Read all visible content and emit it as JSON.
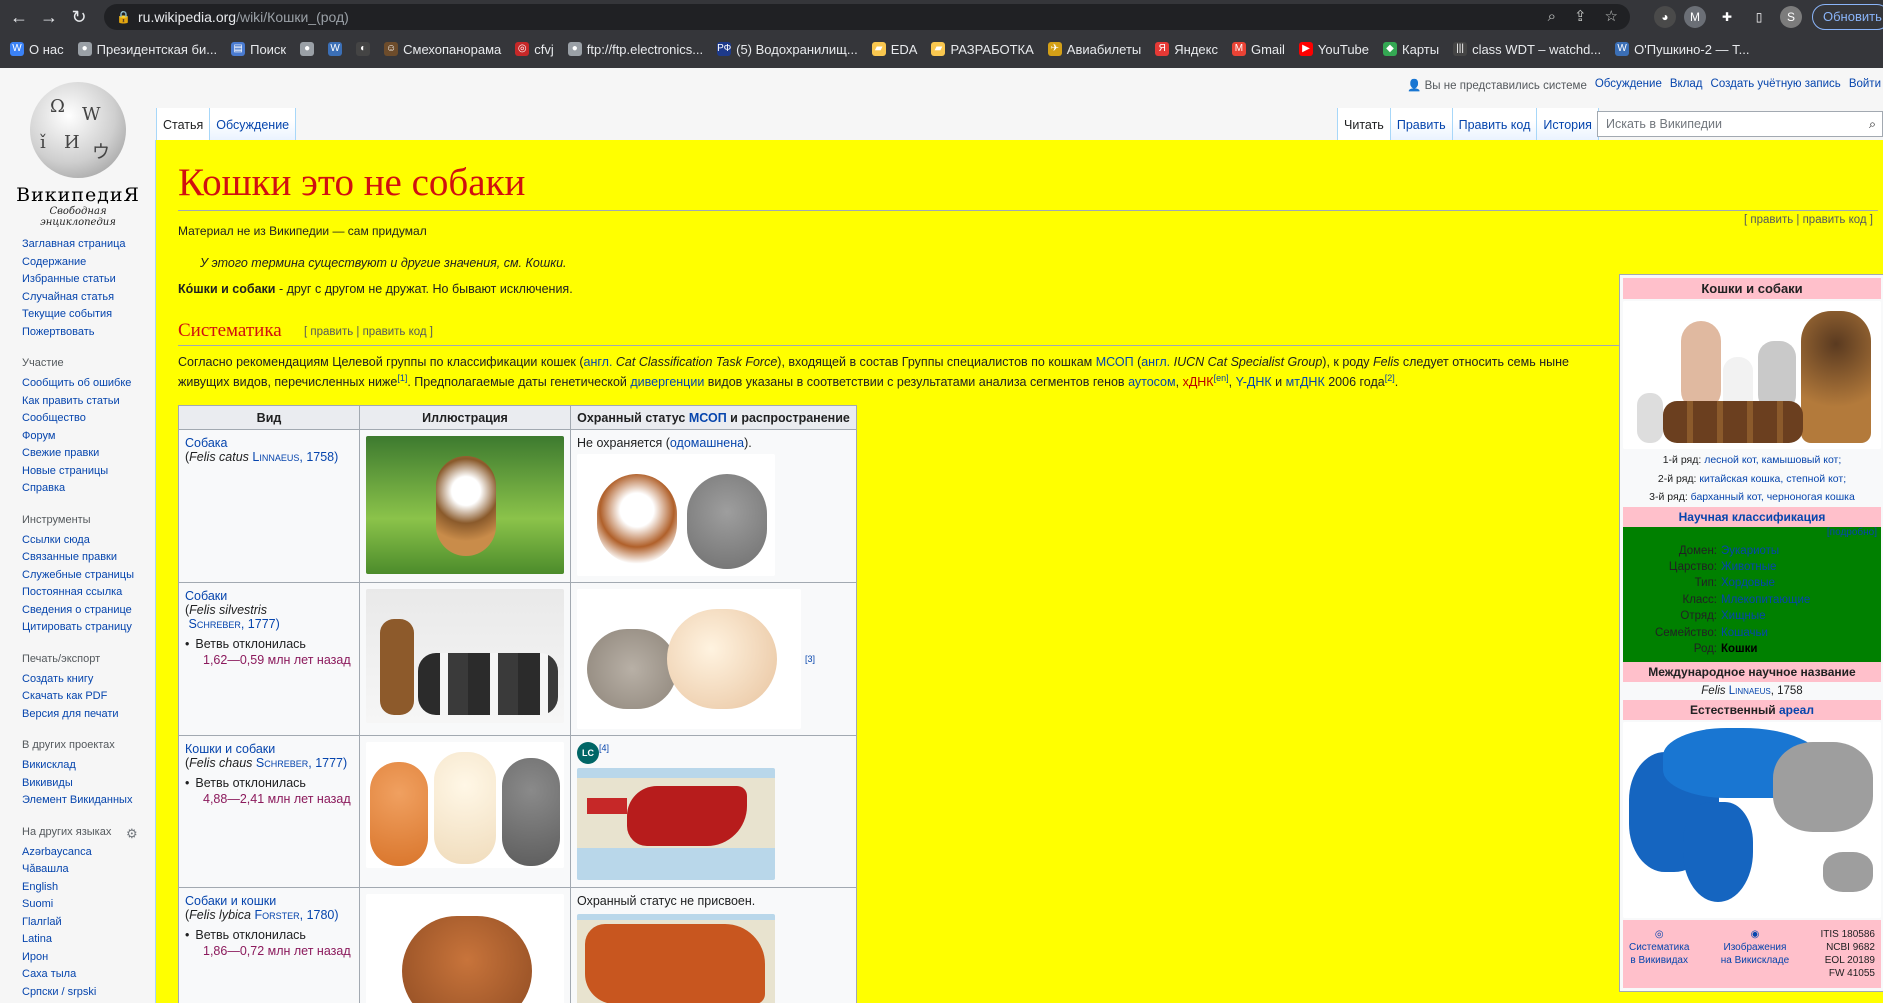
{
  "browser": {
    "url_host": "ru.wikipedia.org",
    "url_path": "/wiki/Кошки_(род)",
    "update_label": "Обновить",
    "profile_initial": "S",
    "bookmarks": [
      {
        "label": "О нас",
        "color": "#3b82f6",
        "icon": "W"
      },
      {
        "label": "Президентская би...",
        "color": "#9aa0a6",
        "icon": "●"
      },
      {
        "label": "Поиск",
        "color": "#4a7bd0",
        "icon": "▤"
      },
      {
        "label": "",
        "color": "#9aa0a6",
        "icon": "●"
      },
      {
        "label": "",
        "color": "#3b6fb6",
        "icon": "W"
      },
      {
        "label": "",
        "color": "#444",
        "icon": "◐"
      },
      {
        "label": "Смехопанорама",
        "color": "#6d4c2b",
        "icon": "☺"
      },
      {
        "label": "cfvj",
        "color": "#c62828",
        "icon": "◎"
      },
      {
        "label": "ftp://ftp.electronics...",
        "color": "#9aa0a6",
        "icon": "●"
      },
      {
        "label": "(5) Водохранилищ...",
        "color": "#1e3a8a",
        "icon": "РФ"
      },
      {
        "label": "EDA",
        "color": "#f9c74f",
        "icon": "▰"
      },
      {
        "label": "РАЗРАБОТКА",
        "color": "#f9c74f",
        "icon": "▰"
      },
      {
        "label": "Авиабилеты",
        "color": "#d4a017",
        "icon": "✈"
      },
      {
        "label": "Яндекс",
        "color": "#e53935",
        "icon": "Я"
      },
      {
        "label": "Gmail",
        "color": "#ea4335",
        "icon": "M"
      },
      {
        "label": "YouTube",
        "color": "#ff0000",
        "icon": "▶"
      },
      {
        "label": "Карты",
        "color": "#34a853",
        "icon": "◆"
      },
      {
        "label": "class WDT – watchd...",
        "color": "#444",
        "icon": "|||"
      },
      {
        "label": "O'Пушкино-2 — Т...",
        "color": "#3b6fb6",
        "icon": "W"
      }
    ]
  },
  "logo": {
    "wordmark": "ВикипедиЯ",
    "tagline": "Свободная энциклопедия"
  },
  "sidebar": {
    "main": [
      "Заглавная страница",
      "Содержание",
      "Избранные статьи",
      "Случайная статья",
      "Текущие события",
      "Пожертвовать"
    ],
    "participation_title": "Участие",
    "participation": [
      "Сообщить об ошибке",
      "Как править статьи",
      "Сообщество",
      "Форум",
      "Свежие правки",
      "Новые страницы",
      "Справка"
    ],
    "tools_title": "Инструменты",
    "tools": [
      "Ссылки сюда",
      "Связанные правки",
      "Служебные страницы",
      "Постоянная ссылка",
      "Сведения о странице",
      "Цитировать страницу"
    ],
    "print_title": "Печать/экспорт",
    "print": [
      "Создать книгу",
      "Скачать как PDF",
      "Версия для печати"
    ],
    "projects_title": "В других проектах",
    "projects": [
      "Викисклад",
      "Викивиды",
      "Элемент Викиданных"
    ],
    "langs_title": "На других языках",
    "langs": [
      "Azərbaycanca",
      "Чӑвашла",
      "English",
      "Suomi",
      "Гӏалгӏай",
      "Latina",
      "Ирон",
      "Саха тыла",
      "Српски / srpski"
    ]
  },
  "personal": {
    "not_logged": "Вы не представились системе",
    "talk": "Обсуждение",
    "contrib": "Вклад",
    "create": "Создать учётную запись",
    "login": "Войти"
  },
  "tabs": {
    "article": "Статья",
    "talk": "Обсуждение",
    "read": "Читать",
    "edit": "Править",
    "edit_source": "Править код",
    "history": "История",
    "search_placeholder": "Искать в Википедии"
  },
  "article": {
    "title": "Кошки это не собаки",
    "subtitle": "Материал не из Википедии — сам придумал",
    "edit_links": "[ править | править код ]",
    "hatnote": "У этого термина существуют и другие значения, см. Кошки.",
    "lead_bold": "Ко́шки и собаки",
    "lead_rest": " - друг с другом не дружат. Но бывают исключения.",
    "section": "Систематика",
    "section_edit": "[ править | править код ]",
    "para1_a": "Согласно рекомендациям Целевой группы по классификации кошек (",
    "para1_engl": "англ.",
    "para1_b": " Cat Classification Task Force",
    "para1_c": "), входящей в состав Группы специалистов по кошкам ",
    "para1_msop": "МСОП",
    "para1_d": " (",
    "para1_e": " IUCN Cat Specialist Group",
    "para1_f": "), к роду ",
    "para1_felis": "Felis",
    "para1_g": " следует относить семь ныне",
    "para2_a": "живущих видов, перечисленных ниже",
    "para2_ref1": "[1]",
    "para2_b": ". Предполагаемые даты генетической ",
    "para2_div": "дивергенции",
    "para2_c": " видов указаны в соответствии с результатами анализа сегментов генов ",
    "para2_auto": "аутосом",
    "para2_d": ", ",
    "para2_x": "хДНК",
    "para2_en": "[en]",
    "para2_e": ", ",
    "para2_y": "Y-ДНК",
    "para2_f": " и ",
    "para2_mt": "мтДНК",
    "para2_g": " 2006 года",
    "para2_ref2": "[2]",
    "para2_h": "."
  },
  "table": {
    "h_species": "Вид",
    "h_illus": "Иллюстрация",
    "h_status_a": "Охранный статус ",
    "h_status_msop": "МСОП",
    "h_status_b": " и распространение",
    "rows": [
      {
        "name": "Собака",
        "latin": "Felis catus",
        "author": "Linnaeus",
        "year": ", 1758)",
        "status": "Не охраняется (",
        "status_link": "одомашнена",
        "status_end": ").",
        "branch": "",
        "mya": ""
      },
      {
        "name": "Собаки",
        "latin": "Felis silvestris",
        "author": "Schreber",
        "year": ", 1777)",
        "status": "",
        "status_link": "",
        "status_end": "",
        "branch": "Ветвь отклонилась",
        "mya": "1,62—0,59 млн лет назад",
        "ref": "[3]"
      },
      {
        "name": "Кошки и собаки",
        "latin": "Felis chaus",
        "author": "Schreber",
        "year": ", 1777)",
        "status": "",
        "status_link": "",
        "status_end": "",
        "branch": "Ветвь отклонилась",
        "mya": "4,88—2,41 млн лет назад",
        "lc": "LC",
        "ref": "[4]"
      },
      {
        "name": "Собаки и кошки",
        "latin": "Felis lybica",
        "author": "Forster",
        "year": ", 1780)",
        "status": "Охранный статус не присвоен.",
        "status_link": "",
        "status_end": "",
        "branch": "Ветвь отклонилась",
        "mya": "1,86—0,72 млн лет назад"
      }
    ]
  },
  "infobox": {
    "title": "Кошки и собаки",
    "cap1_a": "1-й ряд: ",
    "cap1_b": "лесной кот, камышовый кот;",
    "cap2_a": "2-й ряд: ",
    "cap2_b": "китайская кошка, степной кот;",
    "cap3_a": "3-й ряд: ",
    "cap3_b": "барханный кот, черноногая кошка",
    "sci": "Научная классификация",
    "more": "[подробно]",
    "ranks": [
      {
        "k": "Домен:",
        "v": "Эукариоты"
      },
      {
        "k": "Царство:",
        "v": "Животные"
      },
      {
        "k": "Тип:",
        "v": "Хордовые"
      },
      {
        "k": "Класс:",
        "v": "Млекопитающие"
      },
      {
        "k": "Отряд:",
        "v": "Хищные"
      },
      {
        "k": "Семейство:",
        "v": "Кошачьи"
      },
      {
        "k": "Род:",
        "v": "Кошки"
      }
    ],
    "intl": "Международное научное название",
    "intl_latin": "Felis",
    "intl_author": "Linnaeus",
    "intl_year": ", 1758",
    "range_a": "Естественный ",
    "range_b": "ареал",
    "foot_left_a": "Систематика",
    "foot_left_b": "в Викивидах",
    "foot_mid_a": "Изображения",
    "foot_mid_b": "на Викискладе",
    "ids": [
      "ITIS  180586",
      "NCBI  9682",
      "EOL  20189",
      "FW  41055"
    ]
  }
}
